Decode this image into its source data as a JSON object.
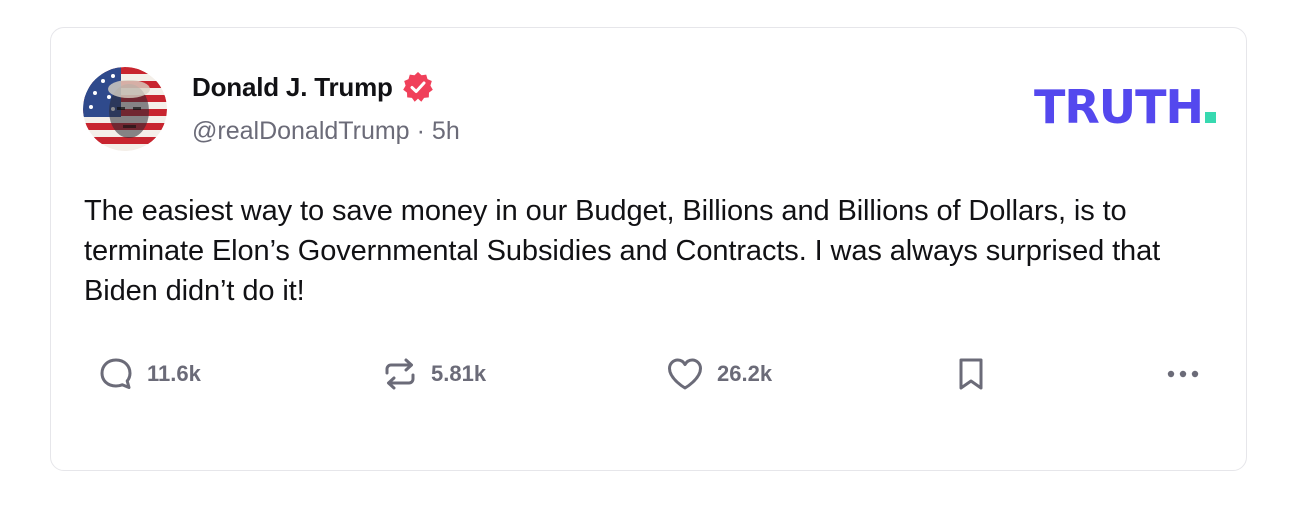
{
  "post": {
    "author": {
      "display_name": "Donald J. Trump",
      "verified": true,
      "handle": "@realDonaldTrump",
      "separator": "·",
      "time": "5h"
    },
    "brand": {
      "logo_text": "TRUTH",
      "colors": {
        "logo": "#5448ee",
        "dot": "#37d9b0",
        "verified": "#f0405a"
      }
    },
    "text": "The easiest way to save money in our Budget, Billions and Billions of Dollars, is to terminate Elon’s Governmental Subsidies and Contracts. I was always surprised that Biden didn’t do it!",
    "actions": {
      "replies": {
        "icon": "comment-icon",
        "count": "11.6k"
      },
      "retruths": {
        "icon": "repost-icon",
        "count": "5.81k"
      },
      "likes": {
        "icon": "heart-icon",
        "count": "26.2k"
      },
      "bookmark": {
        "icon": "bookmark-icon"
      },
      "more": {
        "icon": "more-icon"
      }
    }
  }
}
